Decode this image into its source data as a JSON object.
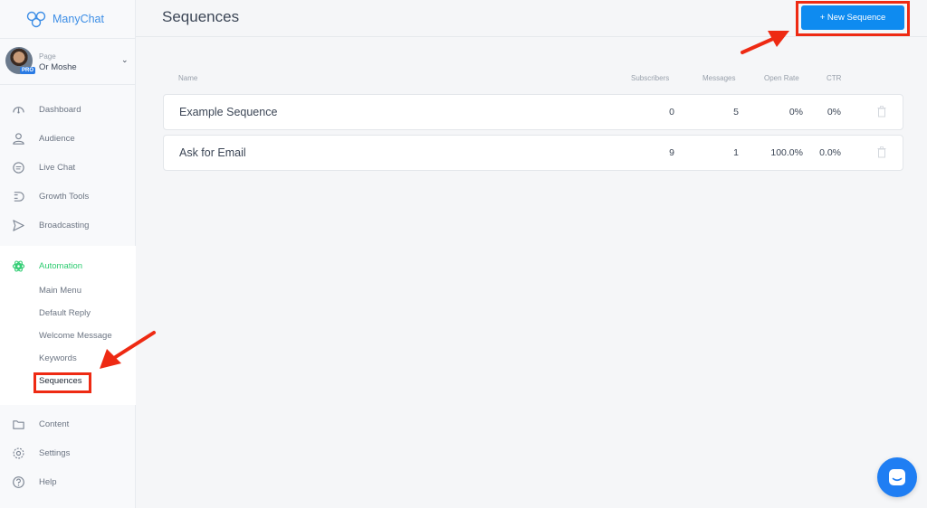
{
  "app": {
    "logo_text": "ManyChat"
  },
  "page_selector": {
    "label": "Page",
    "name": "Or Moshe",
    "badge": "PRO"
  },
  "sidebar": {
    "items": [
      {
        "label": "Dashboard",
        "icon": "dashboard-icon"
      },
      {
        "label": "Audience",
        "icon": "user-icon"
      },
      {
        "label": "Live Chat",
        "icon": "chat-icon"
      },
      {
        "label": "Growth Tools",
        "icon": "magnet-icon"
      },
      {
        "label": "Broadcasting",
        "icon": "send-icon"
      },
      {
        "label": "Automation",
        "icon": "automation-icon"
      },
      {
        "label": "Content",
        "icon": "folder-icon"
      },
      {
        "label": "Settings",
        "icon": "gear-icon"
      },
      {
        "label": "Help",
        "icon": "help-icon"
      }
    ],
    "automation_sub": [
      {
        "label": "Main Menu"
      },
      {
        "label": "Default Reply"
      },
      {
        "label": "Welcome Message"
      },
      {
        "label": "Keywords"
      },
      {
        "label": "Sequences"
      }
    ]
  },
  "header": {
    "title": "Sequences",
    "new_button": "+ New Sequence"
  },
  "table": {
    "columns": [
      "Name",
      "Subscribers",
      "Messages",
      "Open Rate",
      "CTR"
    ],
    "rows": [
      {
        "name": "Example Sequence",
        "subscribers": "0",
        "messages": "5",
        "open_rate": "0%",
        "ctr": "0%"
      },
      {
        "name": "Ask for Email",
        "subscribers": "9",
        "messages": "1",
        "open_rate": "100.0%",
        "ctr": "0.0%"
      }
    ]
  },
  "colors": {
    "accent": "#0e8bf0",
    "active_green": "#2ecc71",
    "annotation_red": "#ee2a13"
  }
}
